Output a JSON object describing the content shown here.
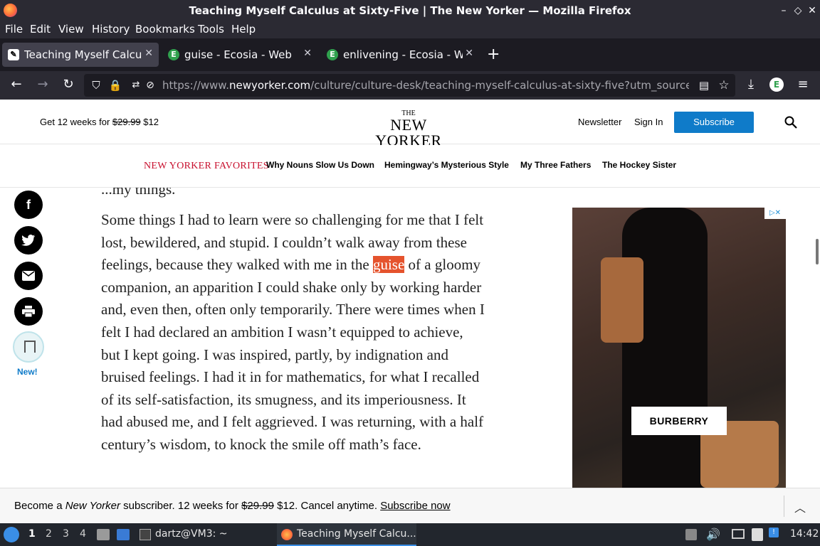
{
  "window": {
    "title": "Teaching Myself Calculus at Sixty-Five | The New Yorker — Mozilla Firefox"
  },
  "menu": [
    "File",
    "Edit",
    "View",
    "History",
    "Bookmarks",
    "Tools",
    "Help"
  ],
  "tabs": [
    {
      "label": "Teaching Myself Calculus"
    },
    {
      "label": "guise - Ecosia - Web"
    },
    {
      "label": "enlivening - Ecosia - Web"
    }
  ],
  "url": {
    "prefix": "https://www.",
    "domain": "newyorker.com",
    "path": "/culture/culture-desk/teaching-myself-calculus-at-sixty-five?utm_source=pock"
  },
  "header": {
    "promo_prefix": "Get 12 weeks for ",
    "promo_old": "$29.99",
    "promo_new": " $12",
    "logo_the": "THE",
    "logo_name": "NEW YORKER",
    "newsletter": "Newsletter",
    "sign_in": "Sign In",
    "subscribe": "Subscribe"
  },
  "favorites": {
    "title": "NEW YORKER FAVORITES",
    "links": [
      "Why Nouns Slow Us Down",
      "Hemingway’s Mysterious Style",
      "My Three Fathers",
      "The Hockey Sister"
    ]
  },
  "share": {
    "facebook": "f",
    "new_label": "New!"
  },
  "article": {
    "cut_line": "...my things.",
    "before": "Some things I had to learn were so challenging for me that I felt lost, bewildered, and stupid. I couldn’t walk away from these feelings, because they walked with me in the ",
    "highlight": "guise",
    "after": " of a gloomy companion, an apparition I could shake only by working harder and, even then, often only temporarily. There were times when I felt I had declared an ambition I wasn’t equipped to achieve, but I kept going. I was inspired, partly, by indignation and bruised feelings. I had it in for mathematics, for what I recalled of its self-satisfaction, its smugness, and its imperiousness. It had abused me, and I felt aggrieved. I was returning, with a half century’s wisdom, to knock the smile off math’s face."
  },
  "ad": {
    "brand": "BURBERRY"
  },
  "banner": {
    "prefix": "Become a ",
    "brand": "New Yorker",
    "middle": " subscriber. 12 weeks for ",
    "old_price": "$29.99",
    "rest": " $12. Cancel anytime. ",
    "cta": "Subscribe now"
  },
  "taskbar": {
    "workspaces": [
      "1",
      "2",
      "3",
      "4"
    ],
    "terminal": "dartz@VM3: ~",
    "active_window": "Teaching Myself Calcu...",
    "clock": "14:42"
  }
}
